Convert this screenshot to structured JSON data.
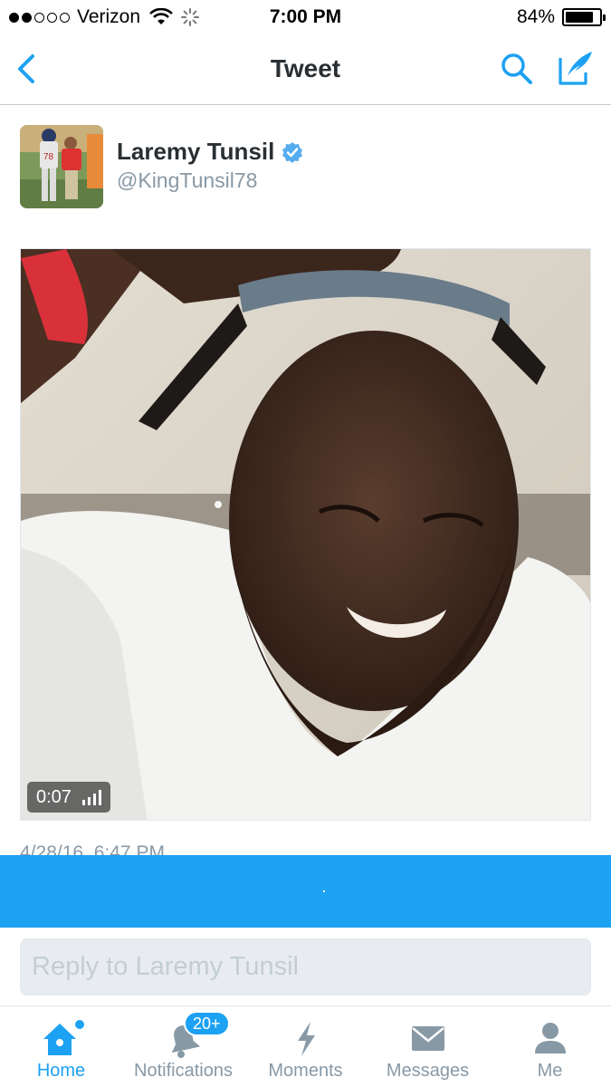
{
  "status_bar": {
    "carrier": "Verizon",
    "time": "7:00 PM",
    "battery": "84%",
    "battery_level": 0.84,
    "signal_bars": 2
  },
  "nav": {
    "title": "Tweet",
    "back_icon": "chevron-left-icon",
    "search_icon": "search-icon",
    "compose_icon": "compose-tweet-icon"
  },
  "tweet": {
    "author_name": "Laremy Tunsil",
    "author_handle": "@KingTunsil78",
    "verified": true,
    "video_duration": "0:07",
    "timestamp": "4/28/16, 6:47 PM"
  },
  "reply": {
    "placeholder": "Reply to Laremy Tunsil"
  },
  "tabs": [
    {
      "label": "Home",
      "icon": "home-icon",
      "active": true,
      "has_dot": true
    },
    {
      "label": "Notifications",
      "icon": "bell-icon",
      "badge": "20+"
    },
    {
      "label": "Moments",
      "icon": "lightning-icon"
    },
    {
      "label": "Messages",
      "icon": "envelope-icon"
    },
    {
      "label": "Me",
      "icon": "person-icon"
    }
  ],
  "colors": {
    "accent": "#1da1f2",
    "text_primary": "#292f33",
    "text_secondary": "#8899a6",
    "reply_bg": "#e8ecf0"
  }
}
